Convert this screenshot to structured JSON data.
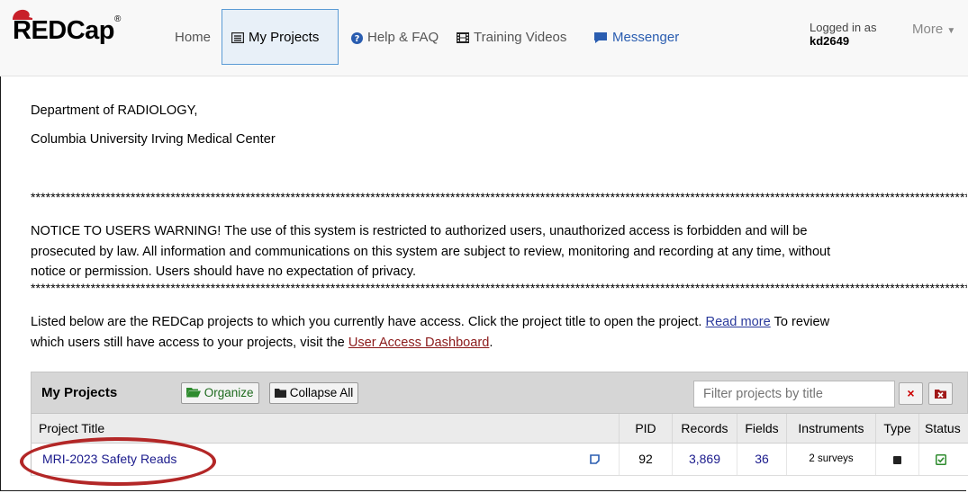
{
  "nav": {
    "logo": "REDCap",
    "logo_mark": "®",
    "home": "Home",
    "my_projects": "My Projects",
    "help": "Help & FAQ",
    "training": "Training Videos",
    "messenger": "Messenger",
    "logged_in_label": "Logged in as",
    "username": "kd2649",
    "more": "More"
  },
  "content": {
    "dept": "Department of RADIOLOGY,",
    "org": "Columbia University Irving Medical Center",
    "stars": "**********************************************************************************************************************************************************************************************",
    "notice_l1": "NOTICE TO USERS WARNING! The use of this system is restricted to authorized users, unauthorized access is forbidden and will be",
    "notice_l2": "prosecuted by law. All information and communications on this system are subject to review, monitoring and recording at any time, without",
    "notice_l3": "notice or permission. Users should have no expectation of privacy.",
    "listed_l1": "Listed below are the REDCap projects to which you currently have access. Click the project title to open the project.",
    "read_more": "Read more",
    "listed_l1b": "To review",
    "listed_l2": "which users still have access to your projects, visit the",
    "user_access": "User Access Dashboard",
    "period": "."
  },
  "panel": {
    "title": "My Projects",
    "organize": "Organize",
    "collapse": "Collapse All",
    "filter_placeholder": "Filter projects by title",
    "clear": "×"
  },
  "table": {
    "headers": [
      "Project Title",
      "PID",
      "Records",
      "Fields",
      "Instruments",
      "Type",
      "Status"
    ],
    "rows": [
      {
        "title": "MRI-2023 Safety Reads",
        "pid": "92",
        "records": "3,869",
        "fields": "36",
        "instruments": "2 surveys"
      }
    ]
  },
  "colors": {
    "accent": "#5b9bd5",
    "link": "#8b1a1a",
    "highlight": "#b32727"
  }
}
